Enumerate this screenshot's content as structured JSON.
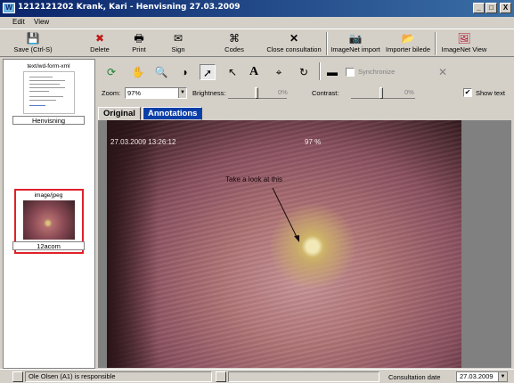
{
  "window": {
    "title": "1212121202 Krank, Kari - Henvisning 27.03.2009",
    "app_icon_letter": "W",
    "minimize": "_",
    "maximize": "□",
    "close": "X"
  },
  "menu": [
    "Edit",
    "View"
  ],
  "toolbar": {
    "buttons": [
      {
        "label": "Save (Ctrl-S)",
        "icon": "floppy-disk-icon",
        "glyph": "💾"
      },
      {
        "label": "Delete",
        "icon": "delete-x-icon",
        "glyph": "✖"
      },
      {
        "label": "Print",
        "icon": "printer-icon",
        "glyph": "🖶"
      },
      {
        "label": "Sign",
        "icon": "stamp-icon",
        "glyph": "✉"
      },
      {
        "label": "Codes",
        "icon": "codes-icon",
        "glyph": "⌘"
      },
      {
        "label": "Close consultation",
        "icon": "close-x-icon",
        "glyph": "✕"
      },
      {
        "label": "ImageNet import",
        "icon": "camera-icon",
        "glyph": "📷"
      },
      {
        "label": "Importer bilede",
        "icon": "folder-icon",
        "glyph": "📂"
      },
      {
        "label": "ImageNet View",
        "icon": "imagenet-view-icon",
        "glyph": "🖼"
      }
    ]
  },
  "thumbnails": [
    {
      "type": "text/wd-form-xml",
      "caption": "Henvisning"
    },
    {
      "type": "image/jpeg",
      "caption": "12acom"
    }
  ],
  "controls": {
    "zoom_label": "Zoom:",
    "zoom_value": "97%",
    "brightness_label": "Brightness:",
    "brightness_value": "0%",
    "contrast_label": "Contrast:",
    "contrast_value": "0%",
    "synchronize_label": "Synchronize",
    "synchronize_checked": false,
    "show_text_label": "Show text",
    "show_text_checked": true,
    "text_tool_glyph": "A"
  },
  "tabs": [
    {
      "label": "Original",
      "active": true
    },
    {
      "label": "Annotations",
      "active": false
    }
  ],
  "viewer": {
    "timestamp": "27.03.2009 13:26:12",
    "zoom_overlay": "97 %",
    "annotation_text": "Take a look at this"
  },
  "status": {
    "responsible": "Ole Olsen (A1) is responsible",
    "consultation_date_label": "Consultation date",
    "consultation_date": "27.03.2009"
  }
}
